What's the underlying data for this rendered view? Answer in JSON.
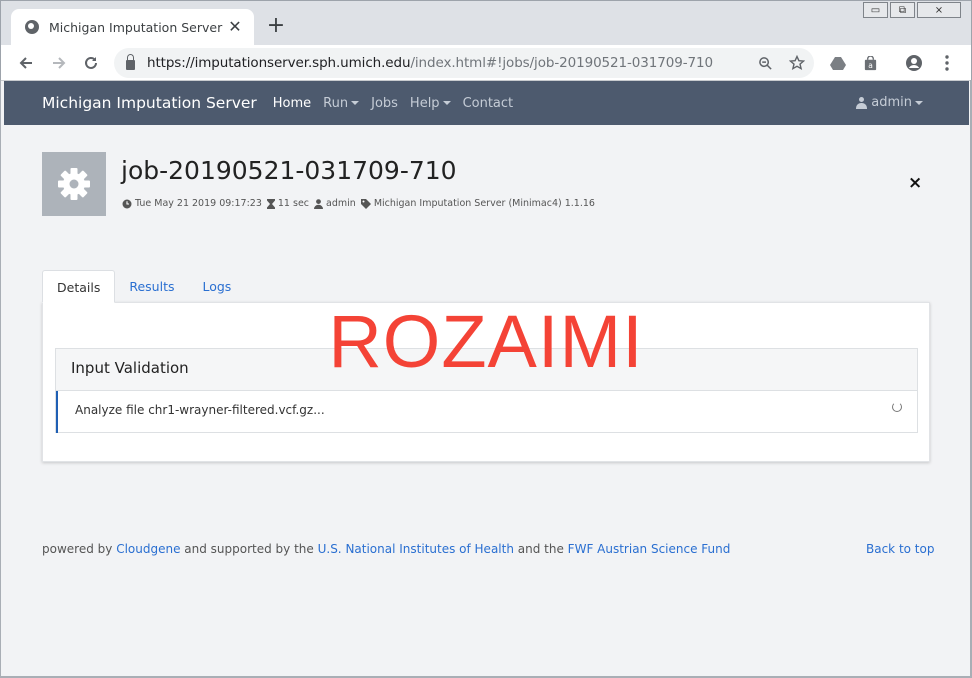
{
  "browser": {
    "tab_title": "Michigan Imputation Server",
    "tab_close": "✕",
    "new_tab": "+",
    "url_host": "https://imputationserver.sph.umich.edu",
    "url_path": "/index.html#!jobs/job-20190521-031709-710",
    "window_controls": {
      "minimize": "▭",
      "restore": "⧉",
      "close": "⨯"
    }
  },
  "navbar": {
    "brand": "Michigan Imputation Server",
    "items": [
      {
        "label": "Home",
        "active": true,
        "dropdown": false
      },
      {
        "label": "Run",
        "active": false,
        "dropdown": true
      },
      {
        "label": "Jobs",
        "active": false,
        "dropdown": false
      },
      {
        "label": "Help",
        "active": false,
        "dropdown": true
      },
      {
        "label": "Contact",
        "active": false,
        "dropdown": false
      }
    ],
    "user": "admin",
    "colors": {
      "background": "#4d5a6e"
    }
  },
  "job": {
    "title": "job-20190521-031709-710",
    "date": "Tue May 21 2019 09:17:23",
    "duration": "11 sec",
    "user": "admin",
    "application": "Michigan Imputation Server (Minimac4) 1.1.16",
    "close_symbol": "×"
  },
  "tabs": [
    {
      "label": "Details",
      "active": true
    },
    {
      "label": "Results",
      "active": false
    },
    {
      "label": "Logs",
      "active": false
    }
  ],
  "watermark": "ROZAIMI",
  "validation": {
    "heading": "Input Validation",
    "row_text": "Analyze file chr1-wrayner-filtered.vcf.gz...",
    "accent": "#1f5fb4"
  },
  "footer": {
    "powered_by": "powered by ",
    "cloudgene": "Cloudgene",
    "supported_by": " and supported by the ",
    "nih": "U.S. National Institutes of Health",
    "and_the": " and the ",
    "fwf": "FWF Austrian Science Fund",
    "back_to_top": "Back to top"
  }
}
